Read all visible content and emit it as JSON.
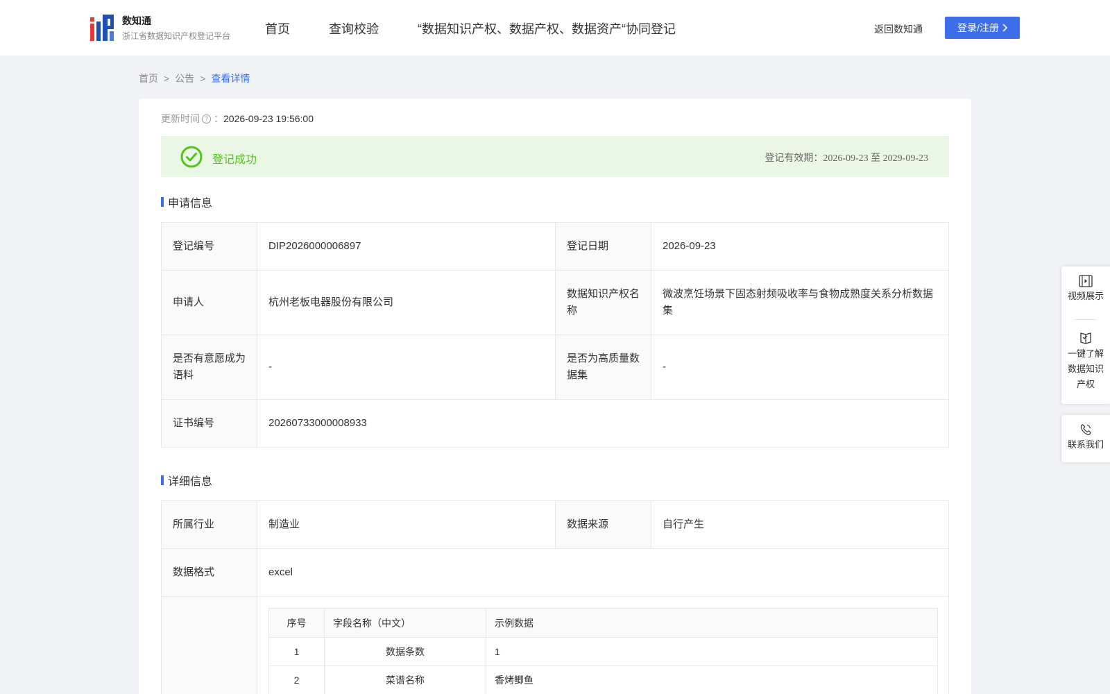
{
  "header": {
    "brand_title": "数知通",
    "brand_subtitle": "浙江省数据知识产权登记平台",
    "nav": [
      "首页",
      "查询校验",
      "“数据知识产权、数据产权、数据资产“协同登记"
    ],
    "back_link": "返回数知通",
    "login_button": "登录/注册"
  },
  "breadcrumb": {
    "items": [
      "首页",
      "公告",
      "查看详情"
    ],
    "separator": ">"
  },
  "update": {
    "label": "更新时间",
    "colon": "：",
    "value": "2026-09-23 19:56:00"
  },
  "status": {
    "text": "登记成功",
    "validity": "登记有效期：2026-09-23 至 2029-09-23",
    "color": "#52c41a"
  },
  "application_info": {
    "title": "申请信息",
    "rows": [
      {
        "l1": "登记编号",
        "v1": "DIP2026000006897",
        "l2": "登记日期",
        "v2": "2026-09-23"
      },
      {
        "l1": "申请人",
        "v1": "杭州老板电器股份有限公司",
        "l2": "数据知识产权名称",
        "v2": "微波烹饪场景下固态射频吸收率与食物成熟度关系分析数据集"
      },
      {
        "l1": "是否有意愿成为语料",
        "v1": "-",
        "l2": "是否为高质量数据集",
        "v2": "-"
      }
    ],
    "cert": {
      "label": "证书编号",
      "value": "20260733000008933"
    }
  },
  "detail_info": {
    "title": "详细信息",
    "industry_label": "所属行业",
    "industry_value": "制造业",
    "source_label": "数据来源",
    "source_value": "自行产生",
    "format_label": "数据格式",
    "format_value": "excel",
    "fields_table": {
      "headers": [
        "序号",
        "字段名称（中文）",
        "示例数据"
      ],
      "rows": [
        [
          "1",
          "数据条数",
          "1"
        ],
        [
          "2",
          "菜谱名称",
          "香烤鲫鱼"
        ]
      ]
    }
  },
  "float_sidebar": {
    "video": "视频展示",
    "learn": [
      "一键了解",
      "数据知识",
      "产权"
    ],
    "contact": "联系我们"
  },
  "colors": {
    "accent": "#3d6de9",
    "success_bg": "#eaf7e4",
    "page_bg": "#f0f2f5"
  }
}
